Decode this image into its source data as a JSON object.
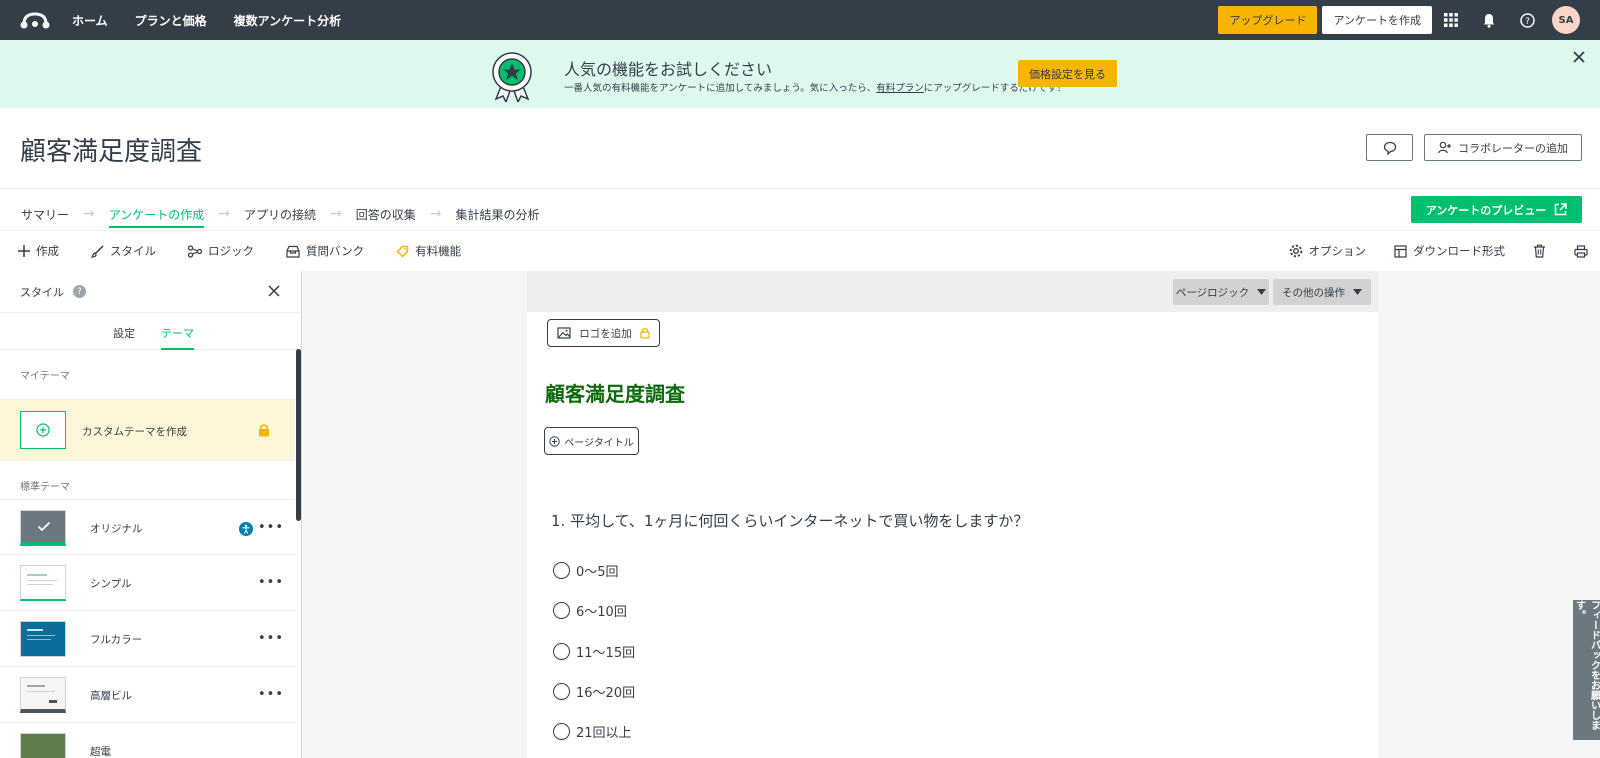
{
  "nav": {
    "links": [
      "ホーム",
      "プランと価格",
      "複数アンケート分析"
    ],
    "upgrade": "アップグレード",
    "create_survey": "アンケートを作成",
    "avatar": "SA"
  },
  "banner": {
    "title": "人気の機能をお試しください",
    "text_before": "一番人気の有料機能をアンケートに追加してみましょう。気に入ったら、",
    "link": "有料プラン",
    "text_after": "にアップグレードするだけです！",
    "button": "価格設定を見る"
  },
  "header": {
    "title": "顧客満足度調査",
    "collaborator": "コラボレーターの追加"
  },
  "steps": [
    {
      "label": "サマリー",
      "active": false
    },
    {
      "label": "アンケートの作成",
      "active": true
    },
    {
      "label": "アプリの接続",
      "active": false
    },
    {
      "label": "回答の収集",
      "active": false
    },
    {
      "label": "集計結果の分析",
      "active": false
    }
  ],
  "preview_button": "アンケートのプレビュー",
  "toolbar": {
    "build": "作成",
    "style": "スタイル",
    "logic": "ロジック",
    "question_bank": "質問バンク",
    "paid_features": "有料機能",
    "options": "オプション",
    "download": "ダウンロード形式"
  },
  "panel": {
    "title": "スタイル",
    "help": "?",
    "tabs": {
      "settings": "設定",
      "theme": "テーマ"
    },
    "my_themes_label": "マイテーマ",
    "custom_theme": "カスタムテーマを作成",
    "standard_themes_label": "標準テーマ",
    "themes": [
      {
        "name": "オリジナル"
      },
      {
        "name": "シンプル"
      },
      {
        "name": "フルカラー"
      },
      {
        "name": "高層ビル"
      },
      {
        "name": "超電"
      }
    ],
    "more": "•••"
  },
  "page": {
    "page_logic": "ページロジック",
    "more_actions": "その他の操作",
    "add_logo": "ロゴを追加",
    "survey_title": "顧客満足度調査",
    "page_title": "ページタイトル",
    "question": "1. 平均して、1ヶ月に何回くらいインターネットで買い物をしますか？",
    "options": [
      "0〜5回",
      "6〜10回",
      "11〜15回",
      "16〜20回",
      "21回以上"
    ]
  },
  "feedback": "フィードバックをお願いします。",
  "colors": {
    "nav_bg": "#333e48",
    "accent": "#00bf6f",
    "upgrade": "#f7b500",
    "banner_bg": "#def8ee",
    "survey_title": "#0b6a0b"
  }
}
